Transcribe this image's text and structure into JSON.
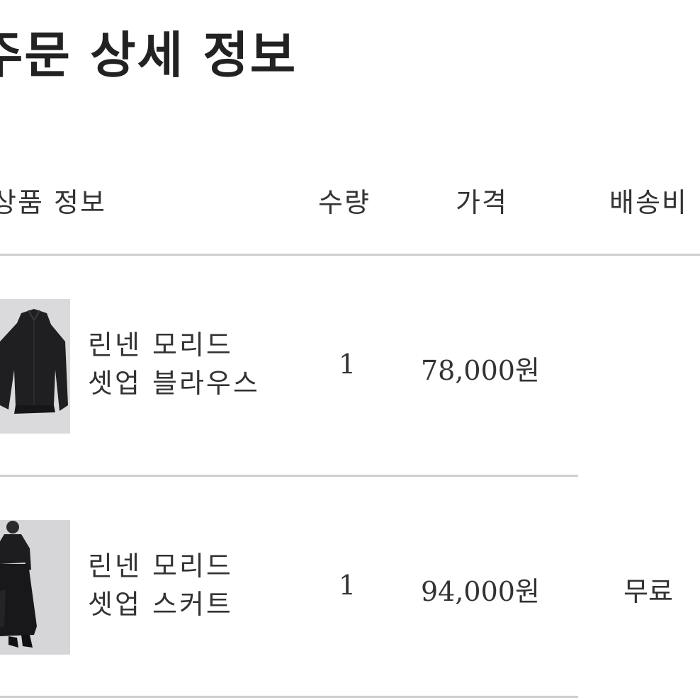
{
  "page": {
    "title": "주문 상세 정보"
  },
  "table": {
    "headers": {
      "product": "상품 정보",
      "quantity": "수량",
      "price": "가격",
      "shipping": "배송비"
    },
    "rows": [
      {
        "name_line1": "린넨 모리드",
        "name_line2": "셋업 블라우스",
        "quantity": "1",
        "price": "78,000원",
        "thumbnail": "black-linen-blouse-photo"
      },
      {
        "name_line1": "린넨 모리드",
        "name_line2": "셋업 스커트",
        "quantity": "1",
        "price": "94,000원",
        "thumbnail": "black-linen-skirt-outfit-photo"
      }
    ],
    "shipping_fee": "무료"
  },
  "colors": {
    "text": "#333333",
    "rule": "#cfcfcf",
    "thumb_bg": "#d9d9db"
  }
}
